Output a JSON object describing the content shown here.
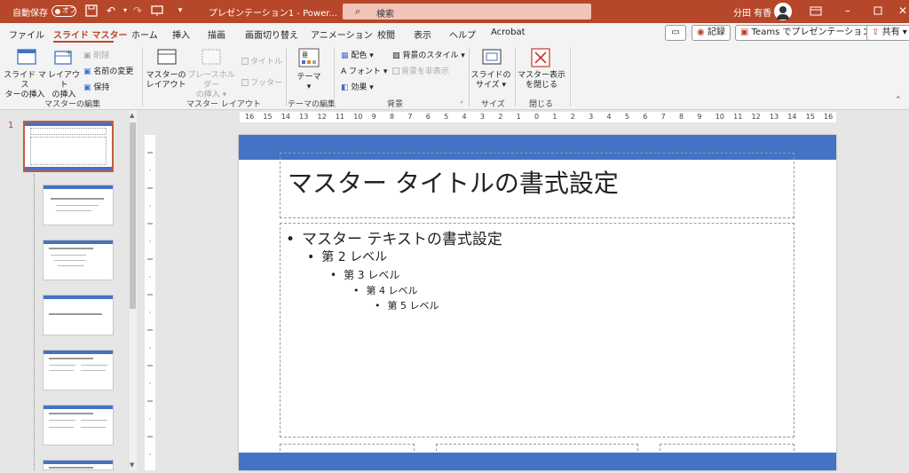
{
  "titlebar": {
    "autosave": "自動保存",
    "doc_title": "プレゼンテーション1 - Power...",
    "search_placeholder": "検索",
    "user_name": "分田 有香"
  },
  "tabs": [
    "ファイル",
    "スライド マスター",
    "ホーム",
    "挿入",
    "描画",
    "画面切り替え",
    "アニメーション",
    "校閲",
    "表示",
    "ヘルプ",
    "Acrobat"
  ],
  "actions": {
    "record": "記録",
    "teams": "Teams でプレゼンテーション",
    "share": "共有"
  },
  "ribbon": {
    "insert_master": [
      "スライド マス",
      "ターの挿入"
    ],
    "insert_layout": [
      "レイアウト",
      "の挿入"
    ],
    "delete": "削除",
    "rename": "名前の変更",
    "preserve": "保持",
    "group_edit_master": "マスターの編集",
    "master_layout": [
      "マスターの",
      "レイアウト"
    ],
    "insert_placeholder": [
      "プレースホルダー",
      "の挿入"
    ],
    "title_chk": "タイトル",
    "footer_chk": "フッター",
    "group_master_layout": "マスター レイアウト",
    "theme": "テーマ",
    "group_edit_theme": "テーマの編集",
    "colors": "配色",
    "fonts": "フォント",
    "effects": "効果",
    "bg_styles": "背景のスタイル",
    "hide_bg": "背景を非表示",
    "group_bg": "背景",
    "slide_size": [
      "スライドの",
      "サイズ"
    ],
    "group_size": "サイズ",
    "close_master": [
      "マスター表示",
      "を閉じる"
    ],
    "group_close": "閉じる"
  },
  "thumbnail_number": "1",
  "slide": {
    "title": "マスター タイトルの書式設定",
    "levels": [
      "マスター テキストの書式設定",
      "第 2 レベル",
      "第 3 レベル",
      "第 4 レベル",
      "第 5 レベル"
    ]
  },
  "ruler_marks": [
    "16",
    "15",
    "14",
    "13",
    "12",
    "11",
    "10",
    "9",
    "8",
    "7",
    "6",
    "5",
    "4",
    "3",
    "2",
    "1",
    "0",
    "1",
    "2",
    "3",
    "4",
    "5",
    "6",
    "7",
    "8",
    "9",
    "10",
    "11",
    "12",
    "13",
    "14",
    "15",
    "16"
  ],
  "colors": {
    "accent": "#b7472a",
    "slide_blue": "#4472c4"
  }
}
